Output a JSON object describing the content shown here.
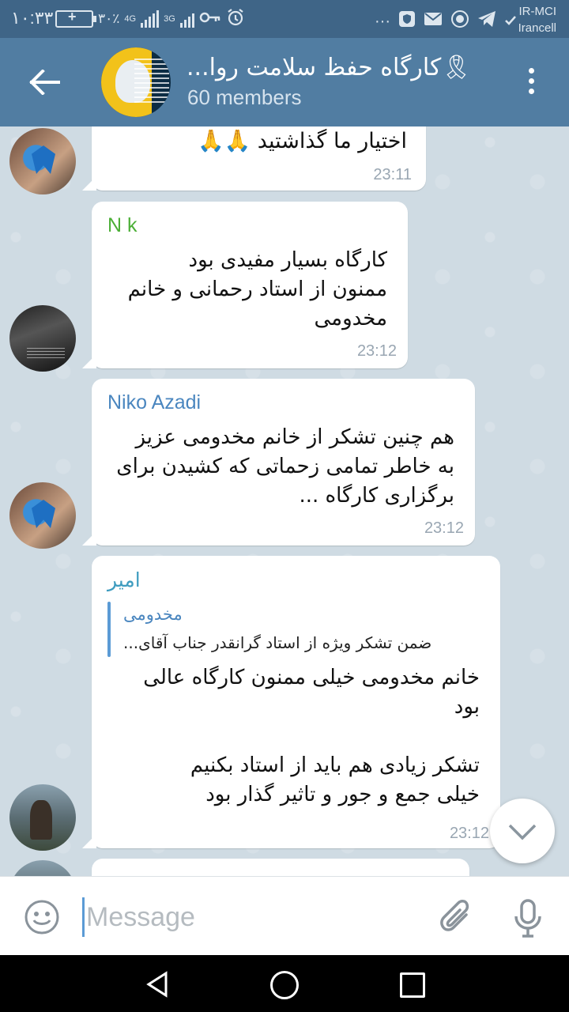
{
  "status_bar": {
    "time": "۱۰:۳۳",
    "battery_percent": "۳۰٪",
    "network_1": "4G",
    "network_2": "3G",
    "carrier_1": "IR-MCI",
    "carrier_2": "Irancell",
    "icons": [
      "battery-icon",
      "signal-icon",
      "key-icon",
      "alarm-icon",
      "more-dots-icon",
      "shield-icon",
      "mail-icon",
      "emblem-icon",
      "telegram-icon",
      "check-icon"
    ]
  },
  "header": {
    "title": "🎗کارگاه حفظ سلامت روا...",
    "subtitle": "60 members"
  },
  "messages": [
    {
      "sender": "",
      "text": "اختیار ما گذاشتید 🙏🙏",
      "time": "23:11"
    },
    {
      "sender": "N k",
      "sender_color": "#4caf37",
      "text": "کارگاه بسیار مفیدی بود\nممنون از استاد رحمانی و خانم\nمخدومی",
      "time": "23:12"
    },
    {
      "sender": "Niko Azadi",
      "sender_color": "#4a86bf",
      "text": "هم چنین تشکر از خانم مخدومی عزیز\nبه خاطر تمامی زحماتی که کشیدن برای\nبرگزاری کارگاه ...",
      "time": "23:12"
    },
    {
      "sender": "امیر",
      "sender_color": "#3e9cbf",
      "reply_author": "مخدومی",
      "reply_text": "ضمن تشکر ویژه از استاد گرانقدر جناب آقای...",
      "text": "خانم مخدومی خیلی ممنون کارگاه عالی\nبود\n\nتشکر زیادی هم باید از استاد بکنیم\nخیلی جمع و جور و تاثیر گذار بود",
      "time": "23:12"
    }
  ],
  "input": {
    "placeholder": "Message"
  },
  "colors": {
    "header": "#517da2",
    "status_bar": "#3f6587",
    "chat_background": "#cfdbe3",
    "bubble": "#ffffff"
  }
}
